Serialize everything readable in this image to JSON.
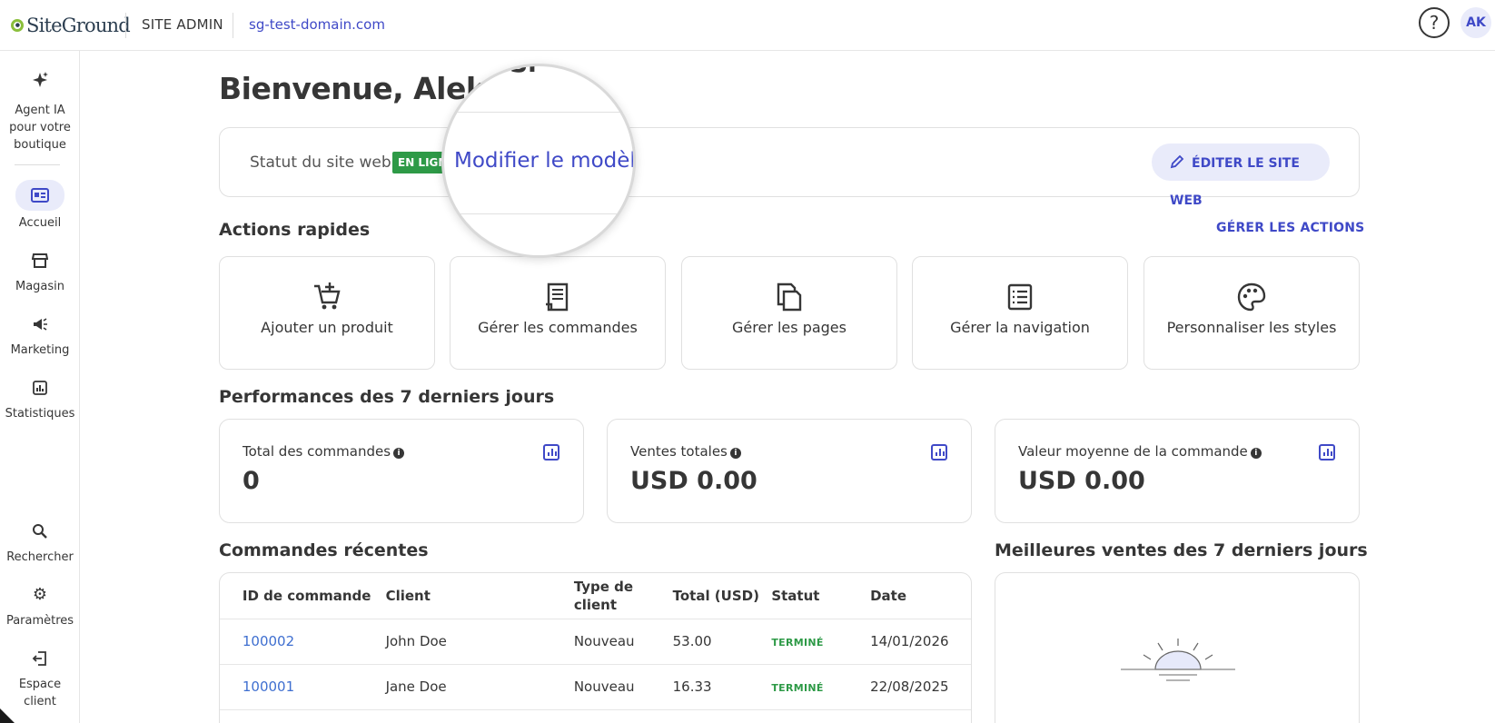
{
  "brand": {
    "name": "SiteGround"
  },
  "header": {
    "site_admin": "SITE ADMIN",
    "domain": "sg-test-domain.com",
    "help": "?",
    "avatar_initials": "AK"
  },
  "sidebar": {
    "items": [
      {
        "label_line1": "Agent IA",
        "label_line2": "pour votre",
        "label_line3": "boutique",
        "icon": "sparkle-icon"
      },
      {
        "label": "Accueil",
        "icon": "dashboard-icon",
        "active": true
      },
      {
        "label": "Magasin",
        "icon": "store-icon"
      },
      {
        "label": "Marketing",
        "icon": "megaphone-icon"
      },
      {
        "label": "Statistiques",
        "icon": "stats-icon"
      },
      {
        "label": "Rechercher",
        "icon": "search-icon"
      },
      {
        "label": "Paramètres",
        "icon": "gear-icon"
      },
      {
        "label_line1": "Espace",
        "label_line2": "client",
        "icon": "logout-icon"
      }
    ]
  },
  "main": {
    "welcome": "Bienvenue, Aleks",
    "status": {
      "label": "Statut du site web:",
      "badge": "EN LIGN",
      "edit_button": "ÉDITER LE SITE WEB"
    },
    "magnifier": {
      "text": "Modifier le modèle"
    },
    "quick_actions": {
      "title": "Actions rapides",
      "manage_link": "GÉRER LES ACTIONS",
      "items": [
        {
          "label": "Ajouter un produit",
          "icon": "add-to-cart-icon"
        },
        {
          "label": "Gérer les commandes",
          "icon": "receipt-icon"
        },
        {
          "label": "Gérer les pages",
          "icon": "pages-icon"
        },
        {
          "label": "Gérer la navigation",
          "icon": "list-icon"
        },
        {
          "label": "Personnaliser les styles",
          "icon": "palette-icon"
        }
      ]
    },
    "performance": {
      "title": "Performances des 7 derniers jours",
      "cards": [
        {
          "label": "Total des commandes",
          "value": "0"
        },
        {
          "label": "Ventes totales",
          "value": "USD 0.00"
        },
        {
          "label": "Valeur moyenne de la commande",
          "value": "USD 0.00"
        }
      ]
    },
    "recent_orders": {
      "title": "Commandes récentes",
      "columns": [
        "ID de commande",
        "Client",
        "Type de client",
        "Total (USD)",
        "Statut",
        "Date"
      ],
      "rows": [
        {
          "id": "100002",
          "client": "John Doe",
          "type": "Nouveau",
          "total": "53.00",
          "status": "TERMINÉ",
          "date": "14/01/2026"
        },
        {
          "id": "100001",
          "client": "Jane Doe",
          "type": "Nouveau",
          "total": "16.33",
          "status": "TERMINÉ",
          "date": "22/08/2025"
        }
      ]
    },
    "best_sellers": {
      "title": "Meilleures ventes des 7 derniers jours"
    }
  }
}
